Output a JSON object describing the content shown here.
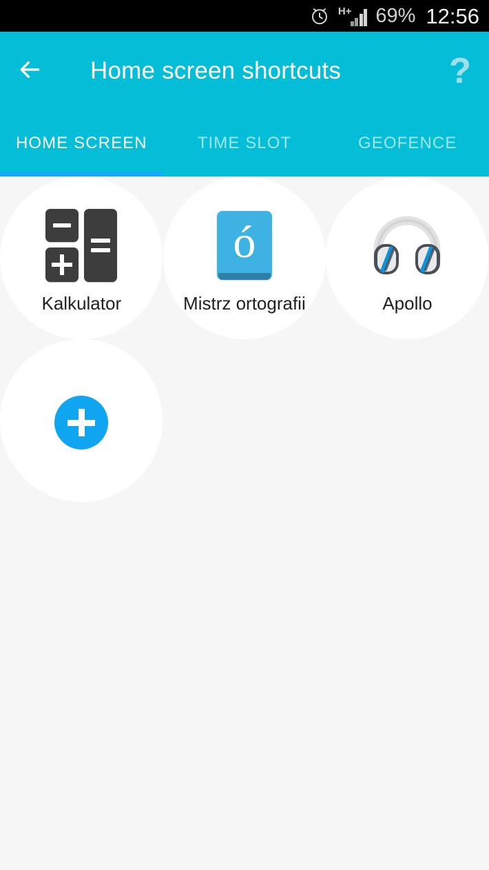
{
  "status_bar": {
    "alarm_icon": "alarm-clock-icon",
    "network_type": "H+",
    "signal_icon": "signal-bars-icon",
    "battery": "69%",
    "clock": "12:56"
  },
  "app_bar": {
    "back_icon": "back-arrow-icon",
    "title": "Home screen shortcuts",
    "help_icon": "help-question-mark-icon",
    "help_label": "?"
  },
  "tabs": {
    "items": [
      {
        "label": "HOME SCREEN",
        "active": true
      },
      {
        "label": "TIME SLOT",
        "active": false
      },
      {
        "label": "GEOFENCE",
        "active": false
      }
    ],
    "indicator_color": "#16a9f5"
  },
  "shortcuts": [
    {
      "label": "Kalkulator",
      "icon": "calculator-icon"
    },
    {
      "label": "Mistrz ortografii",
      "icon": "letter-o-acute-book-icon"
    },
    {
      "label": "Apollo",
      "icon": "headphones-icon"
    }
  ],
  "add_button": {
    "icon": "plus-icon",
    "label": "+"
  },
  "colors": {
    "accent_cyan": "#04bdd6",
    "indicator_blue": "#16a9f5",
    "fab_blue": "#0fa5f0",
    "page_background": "#f6f6f7",
    "tile_background": "#ffffff",
    "label_text": "#212121"
  }
}
